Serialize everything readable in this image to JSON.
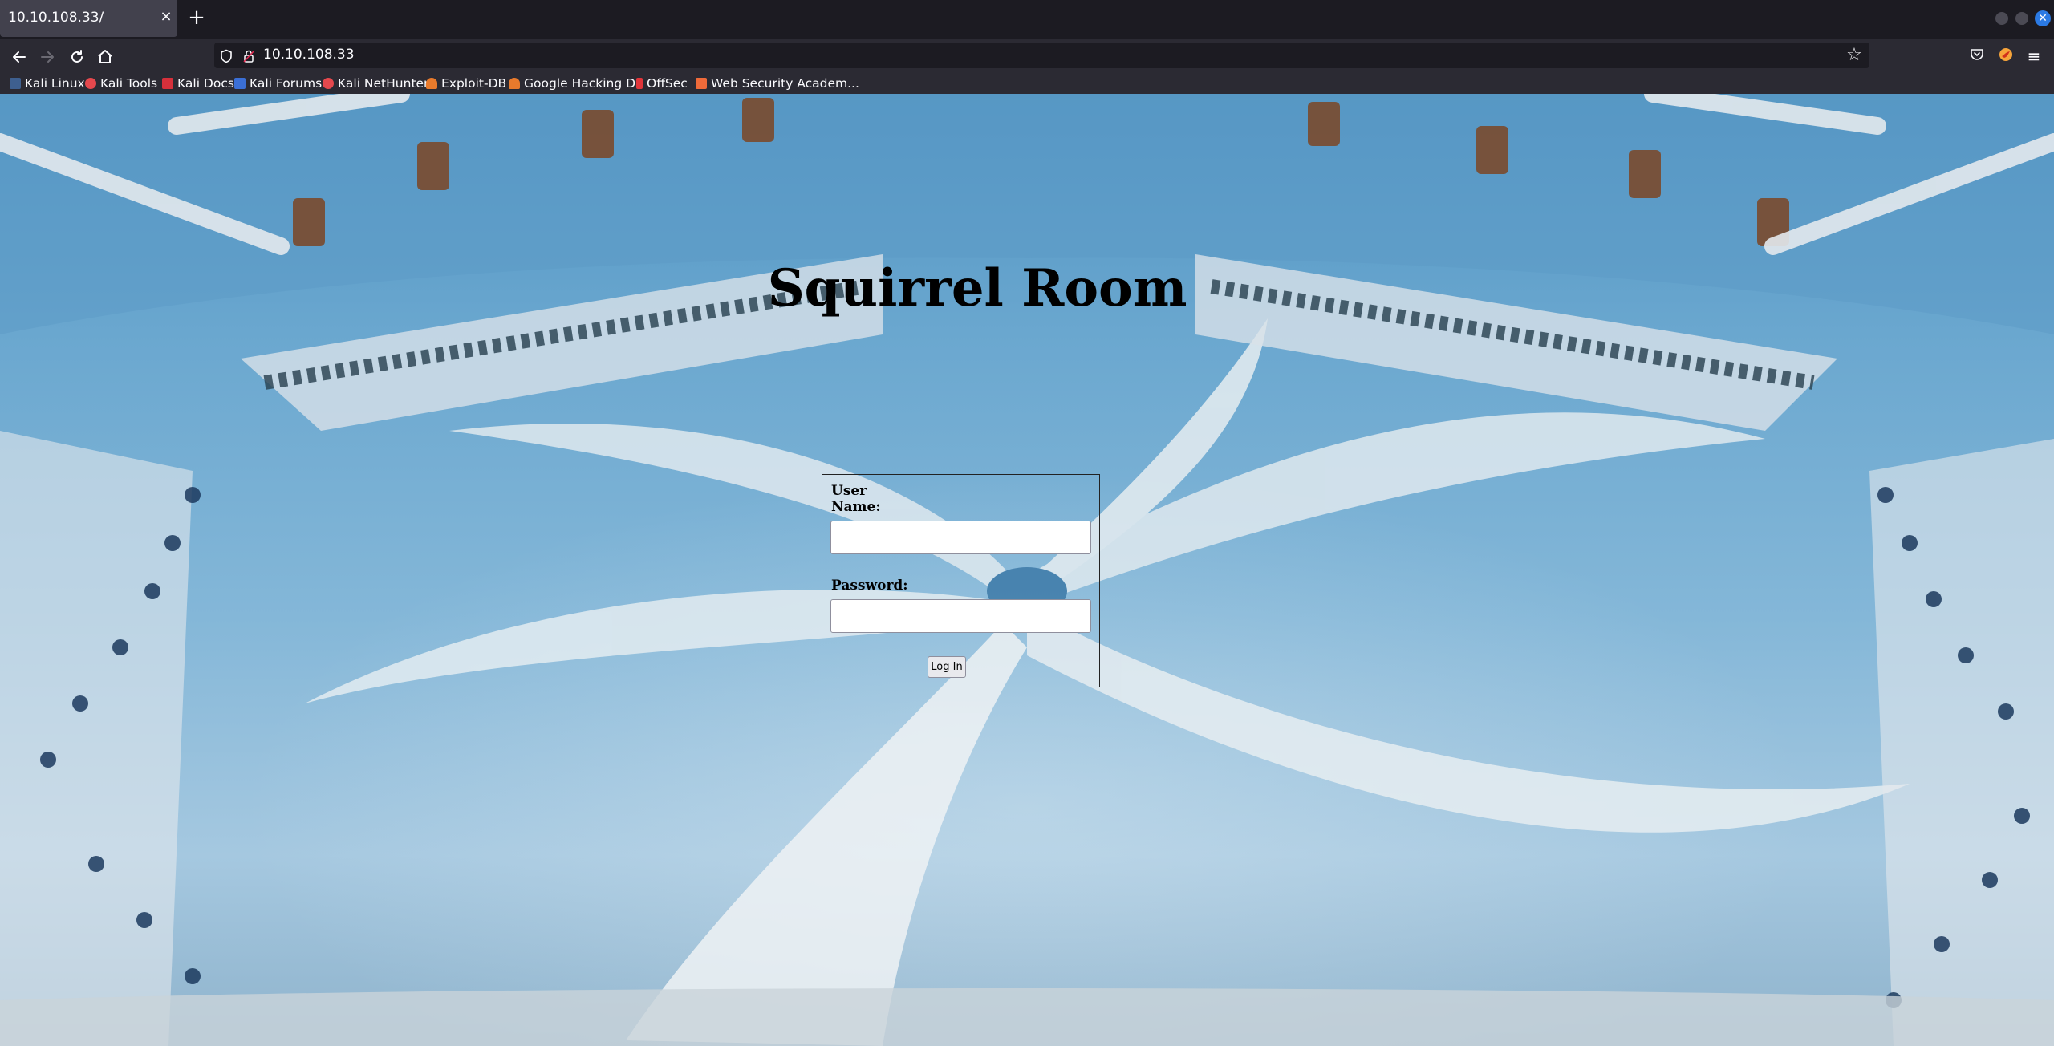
{
  "browser": {
    "tab": {
      "title": "10.10.108.33/",
      "close_label": "×"
    },
    "new_tab_label": "+",
    "address_bar": {
      "url": "10.10.108.33"
    },
    "bookmarks": [
      {
        "label": "Kali Linux",
        "icon": "kali-dragon-icon",
        "color": "#5a86c8"
      },
      {
        "label": "Kali Tools",
        "icon": "kali-red-icon",
        "color": "#e5484d"
      },
      {
        "label": "Kali Docs",
        "icon": "kali-docs-icon",
        "color": "#d6303b"
      },
      {
        "label": "Kali Forums",
        "icon": "kali-forums-icon",
        "color": "#3b6fd6"
      },
      {
        "label": "Kali NetHunter",
        "icon": "kali-red-icon",
        "color": "#e5484d"
      },
      {
        "label": "Exploit-DB",
        "icon": "exploit-db-icon",
        "color": "#e87a2c"
      },
      {
        "label": "Google Hacking DB",
        "icon": "exploit-db-icon",
        "color": "#e87a2c"
      },
      {
        "label": "OffSec",
        "icon": "offsec-icon",
        "color": "#e0353a"
      },
      {
        "label": "Web Security Academ...",
        "icon": "portswigger-icon",
        "color": "#ef6a3a"
      }
    ]
  },
  "page": {
    "title": "Squirrel Room",
    "form": {
      "username_label_line1": "User",
      "username_label_line2": "Name:",
      "username_value": "",
      "password_label": "Password:",
      "password_value": "",
      "submit_label": "Log In"
    }
  }
}
